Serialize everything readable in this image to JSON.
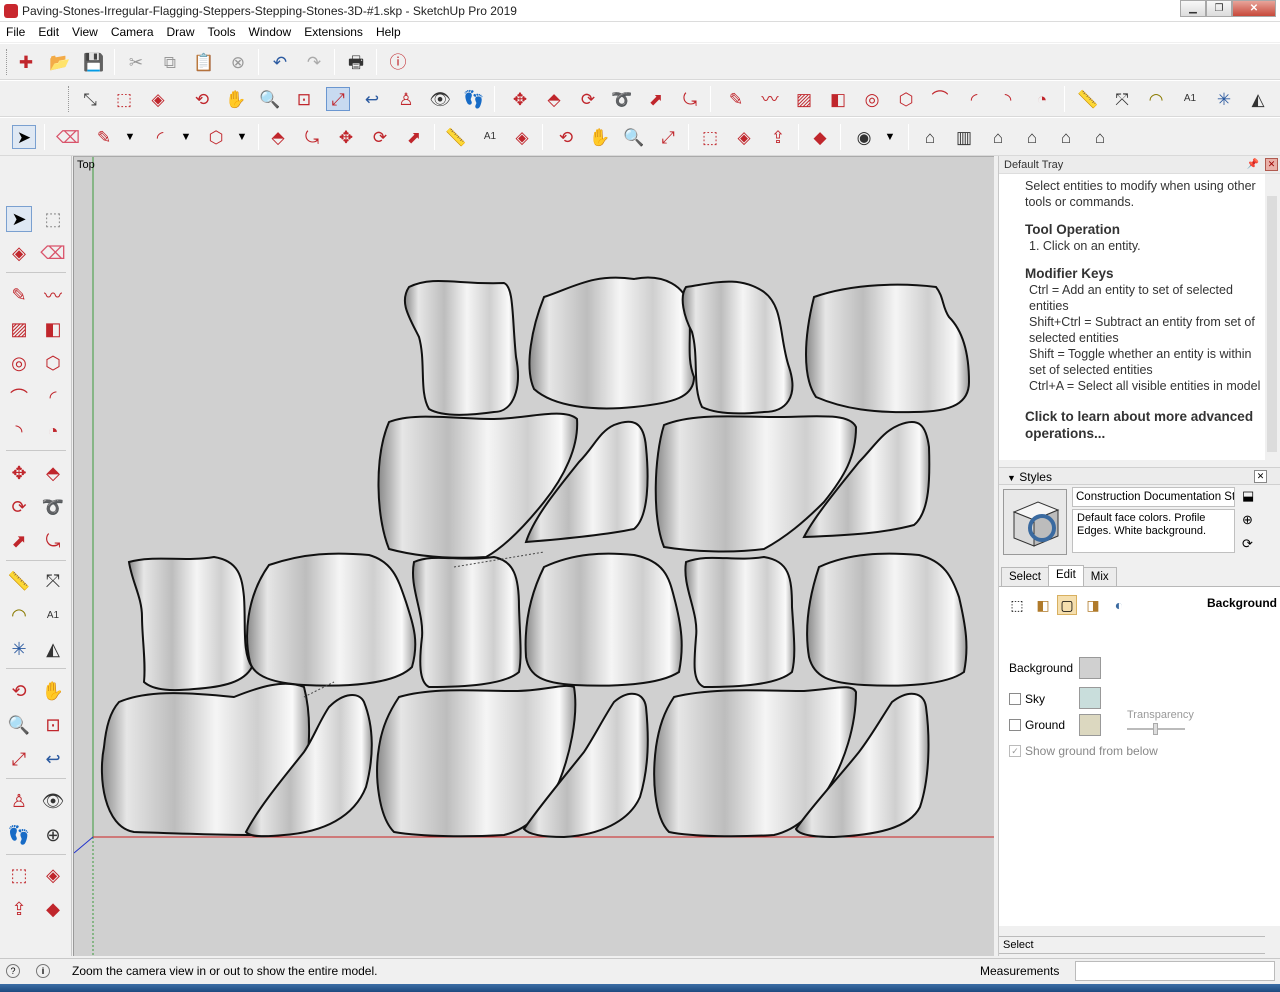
{
  "window": {
    "title": "Paving-Stones-Irregular-Flagging-Steppers-Stepping-Stones-3D-#1.skp - SketchUp Pro 2019",
    "minimize_icon": "minimize-icon",
    "maximize_icon": "restore-icon",
    "close_label": "✕"
  },
  "menu": [
    "File",
    "Edit",
    "View",
    "Camera",
    "Draw",
    "Tools",
    "Window",
    "Extensions",
    "Help"
  ],
  "toolbar1_icons": [
    "new-model-icon",
    "open-icon",
    "save-icon",
    "cut-icon",
    "copy-icon",
    "paste-icon",
    "erase-icon",
    "undo-icon",
    "redo-icon",
    "print-icon",
    "model-info-icon"
  ],
  "toolbar2_icons": [
    "select-icon",
    "component-icon",
    "paint-bucket-icon",
    "orbit-icon",
    "pan-icon",
    "zoom-icon",
    "zoom-window-icon",
    "zoom-extents-icon",
    "previous-view-icon",
    "position-camera-icon",
    "look-around-icon",
    "walk-icon",
    "move-icon",
    "push-pull-icon",
    "rotate-icon",
    "follow-me-icon",
    "scale-icon",
    "offset-icon",
    "line-icon",
    "freehand-icon",
    "rectangle-icon",
    "rotated-rectangle-icon",
    "circle-icon",
    "polygon-icon",
    "arc-icon",
    "two-point-arc-icon",
    "three-point-arc-icon",
    "pie-icon",
    "tape-measure-icon",
    "dimension-icon",
    "protractor-icon",
    "text-icon",
    "axes-icon",
    "section-plane-icon"
  ],
  "viewport": {
    "label": "Top"
  },
  "tray": {
    "title": "Default Tray",
    "instructor": {
      "intro": "Select entities to modify when using other tools or commands.",
      "tool_operation_heading": "Tool Operation",
      "tool_operation_step": "1. Click on an entity.",
      "modifier_heading": "Modifier Keys",
      "modifiers": [
        "Ctrl = Add an entity to set of selected entities",
        "Shift+Ctrl = Subtract an entity from set of selected entities",
        "Shift = Toggle whether an entity is within set of selected entities",
        "Ctrl+A = Select all visible entities in model"
      ],
      "learn_more": "Click to learn about more advanced operations..."
    },
    "styles": {
      "heading": "Styles",
      "style_name": "Construction Documentation Style",
      "style_description": "Default face colors. Profile Edges. White background.",
      "tabs": [
        "Select",
        "Edit",
        "Mix"
      ],
      "active_tab": "Edit",
      "section_label": "Background",
      "background_label": "Background",
      "sky_label": "Sky",
      "ground_label": "Ground",
      "transparency_label": "Transparency",
      "show_ground_label": "Show ground from below",
      "colors": {
        "background": "#d0d0d0",
        "sky": "#c9dedc",
        "ground": "#dcd8c0"
      },
      "sky_checked": false,
      "ground_checked": false,
      "show_ground_checked": true
    },
    "bottom_label": "Select"
  },
  "status": {
    "hint": "Zoom the camera view in or out to show the entire model.",
    "measurements_label": "Measurements",
    "measurements_value": ""
  }
}
